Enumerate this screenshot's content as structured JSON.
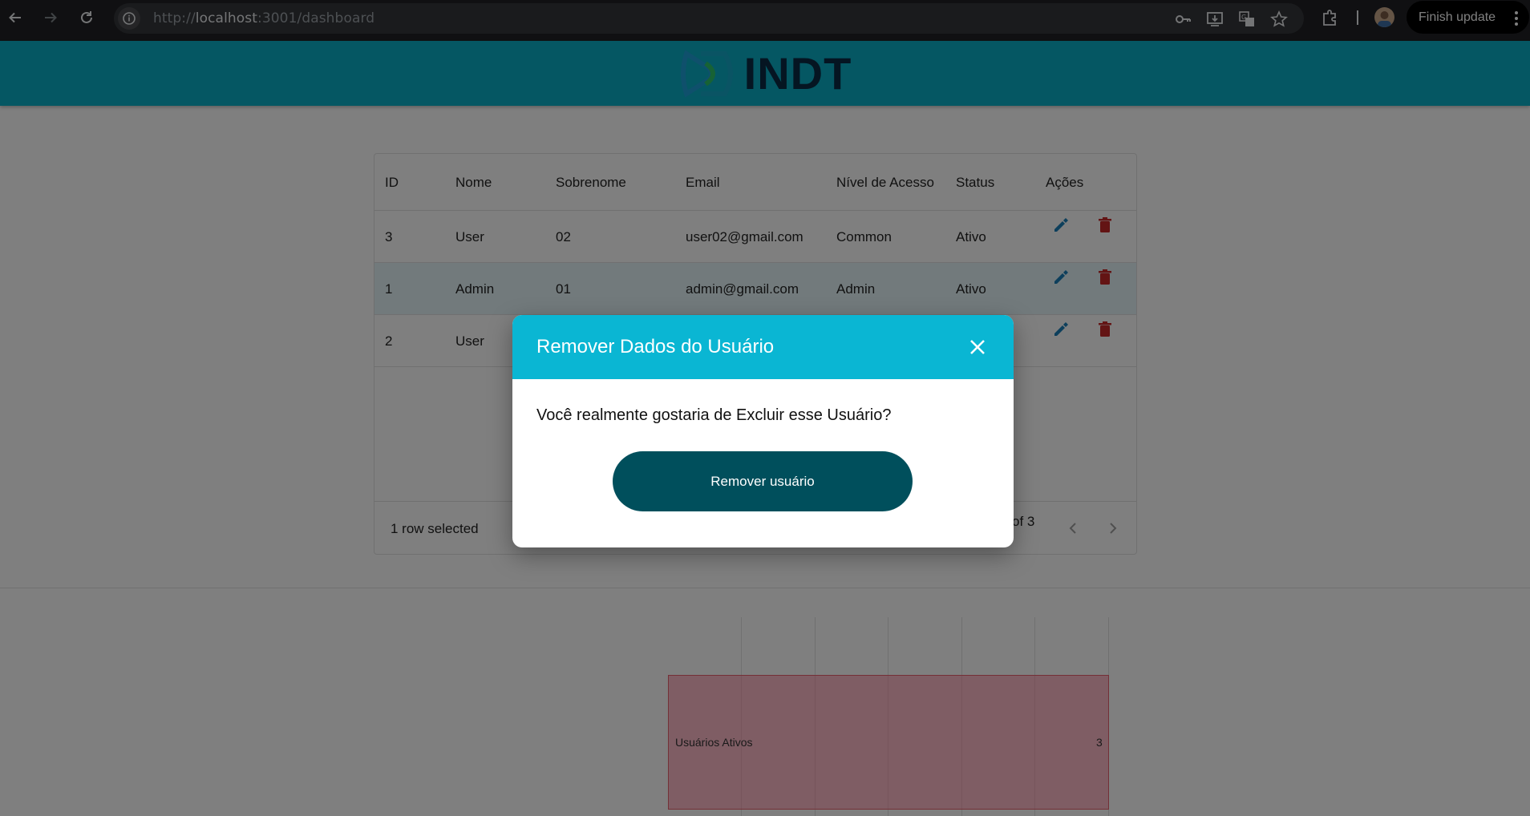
{
  "browser": {
    "url_scheme": "http://",
    "url_host": "localhost",
    "url_path": ":3001/dashboard",
    "finish_update_label": "Finish update"
  },
  "header": {
    "logo_text": "INDT"
  },
  "table": {
    "columns": [
      "ID",
      "Nome",
      "Sobrenome",
      "Email",
      "Nível de Acesso",
      "Status",
      "Ações"
    ],
    "rows": [
      {
        "id": "3",
        "nome": "User",
        "sobrenome": "02",
        "email": "user02@gmail.com",
        "nivel": "Common",
        "status": "Ativo",
        "selected": false
      },
      {
        "id": "1",
        "nome": "Admin",
        "sobrenome": "01",
        "email": "admin@gmail.com",
        "nivel": "Admin",
        "status": "Ativo",
        "selected": true
      },
      {
        "id": "2",
        "nome": "User",
        "sobrenome": "",
        "email": "",
        "nivel": "",
        "status": "",
        "selected": false
      }
    ],
    "footer": {
      "selected_text": "1 row selected",
      "pagination_text": "of 3"
    }
  },
  "chart_data": {
    "type": "bar",
    "orientation": "horizontal",
    "categories": [
      "Usuários Ativos"
    ],
    "values": [
      3
    ],
    "bar_color": "#e8606f"
  },
  "modal": {
    "title": "Remover Dados do Usuário",
    "message": "Você realmente gostaria de Excluir esse Usuário?",
    "confirm_label": "Remover usuário"
  },
  "colors": {
    "header_bg": "#0aaec6",
    "modal_header_bg": "#0ab6d3",
    "primary_button": "#004f5c",
    "edit_icon": "#1a7fb8",
    "delete_icon": "#c62828"
  }
}
